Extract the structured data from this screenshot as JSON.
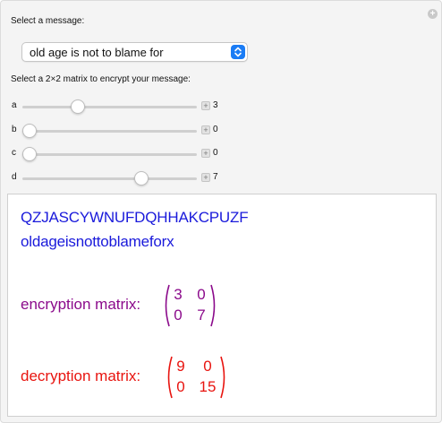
{
  "header": {
    "select_prompt": "Select a message:",
    "selected_message": "old age is not to blame for",
    "matrix_prompt": "Select a 2×2 matrix to encrypt your message:"
  },
  "sliders": [
    {
      "name": "a",
      "value": "3",
      "fraction": 0.3
    },
    {
      "name": "b",
      "value": "0",
      "fraction": 0.0
    },
    {
      "name": "c",
      "value": "0",
      "fraction": 0.0
    },
    {
      "name": "d",
      "value": "7",
      "fraction": 0.7
    }
  ],
  "output": {
    "ciphertext": "QZJASCYWNUFDQHHAKCPUZF",
    "plaintext": "oldageisnottoblameforx",
    "encryption_label": "encryption matrix:",
    "encryption_matrix": [
      [
        "3",
        "0"
      ],
      [
        "0",
        "7"
      ]
    ],
    "decryption_label": "decryption matrix:",
    "decryption_matrix": [
      [
        "9",
        "0"
      ],
      [
        "0",
        "15"
      ]
    ]
  },
  "colors": {
    "text_blue": "#1a1adb",
    "encryption_purple": "#8b0a8b",
    "decryption_red": "#e8140f",
    "accent_blue": "#1a7cf5"
  },
  "icons": {
    "corner": "plus-circle-icon",
    "select": "chevron-updown-icon",
    "slider_step": "plus-square-icon"
  }
}
